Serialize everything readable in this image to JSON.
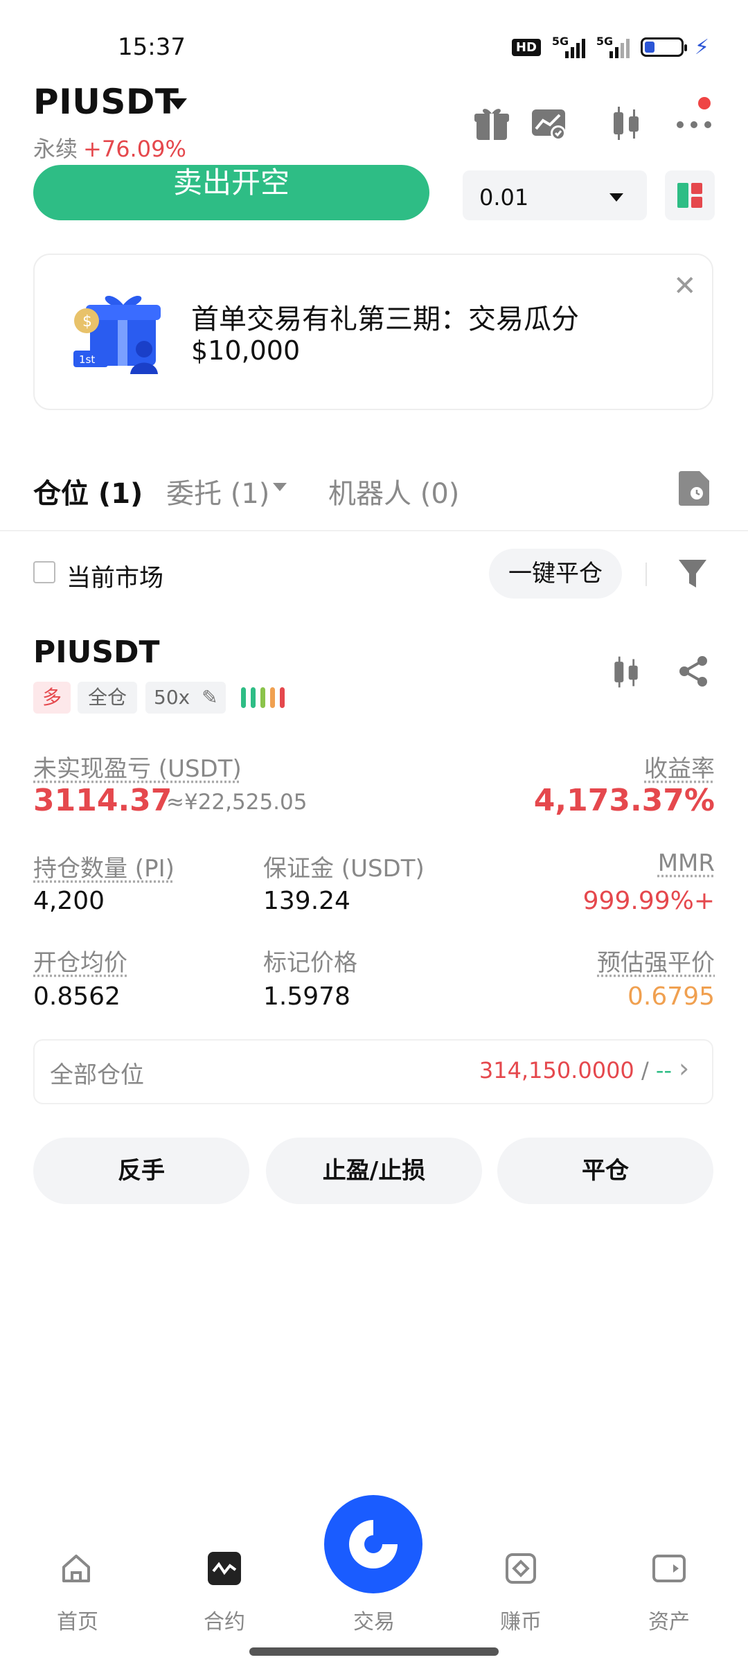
{
  "status_bar": {
    "time": "15:37",
    "hd": "HD",
    "net1": "5G",
    "net2": "5G"
  },
  "header": {
    "symbol": "PIUSDT",
    "contract_type": "永续",
    "change": "+76.09%",
    "icons": [
      "gift-icon",
      "chart-check-icon",
      "candlestick-icon",
      "more-icon"
    ]
  },
  "order": {
    "sell_label": "卖出开空",
    "quantity": "0.01"
  },
  "promo": {
    "title": "首单交易有礼第三期：交易瓜分",
    "amount": "$10,000",
    "badge": "1st"
  },
  "tabs": [
    {
      "label": "仓位 (1)",
      "active": true
    },
    {
      "label": "委托 (1)",
      "active": false
    },
    {
      "label": "机器人 (0)",
      "active": false
    }
  ],
  "filter": {
    "current_market_label": "当前市场",
    "close_all_label": "一键平仓"
  },
  "position": {
    "symbol": "PIUSDT",
    "side_tag": "多",
    "margin_mode": "全仓",
    "leverage": "50x",
    "unrealized_pnl_label": "未实现盈亏 (USDT)",
    "unrealized_pnl": "3114.37",
    "unrealized_pnl_cny": "≈¥22,525.05",
    "roe_label": "收益率",
    "roe": "4,173.37%",
    "size_label": "持仓数量 (PI)",
    "size": "4,200",
    "margin_label": "保证金 (USDT)",
    "margin": "139.24",
    "mmr_label": "MMR",
    "mmr": "999.99%+",
    "entry_label": "开仓均价",
    "entry": "0.8562",
    "mark_label": "标记价格",
    "mark": "1.5978",
    "liq_label": "预估强平价",
    "liq": "0.6795",
    "all_positions_label": "全部仓位",
    "all_positions_value": "314,150.0000",
    "all_positions_slash": " / ",
    "all_positions_dash": "--"
  },
  "actions": {
    "reverse": "反手",
    "tpsl": "止盈/止损",
    "close": "平仓"
  },
  "colors": {
    "green": "#2ebd85",
    "red": "#e5484d",
    "orange": "#f0a050",
    "blue": "#1a5cff"
  },
  "bottom_nav": [
    {
      "label": "首页",
      "icon": "home-icon"
    },
    {
      "label": "合约",
      "icon": "futures-icon"
    },
    {
      "label": "交易",
      "icon": "trade-icon"
    },
    {
      "label": "赚币",
      "icon": "earn-icon"
    },
    {
      "label": "资产",
      "icon": "assets-icon"
    }
  ]
}
